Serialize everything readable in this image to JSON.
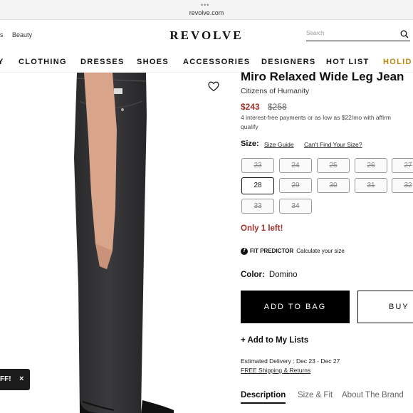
{
  "browser": {
    "url": "revolve.com",
    "dots": "•••"
  },
  "header": {
    "links": [
      "s",
      "Beauty"
    ],
    "logo": "REVOLVE",
    "search_placeholder": "Search"
  },
  "nav": {
    "items": [
      "Y",
      "CLOTHING",
      "DRESSES",
      "SHOES",
      "ACCESSORIES",
      "DESIGNERS",
      "HOT LIST",
      "HOLID"
    ]
  },
  "promo": {
    "text": "FF!",
    "close": "×"
  },
  "product": {
    "title": "Miro Relaxed Wide Leg Jean",
    "brand": "Citizens of Humanity",
    "price": "$243",
    "original_price": "$258",
    "affirm_text": "4 interest-free payments or as low as $22/mo with affirm",
    "affirm_qualify": "qualify",
    "size_label": "Size:",
    "size_guide": "Size Guide",
    "cant_find": "Can't Find Your Size?",
    "sizes": [
      {
        "label": "23",
        "available": false
      },
      {
        "label": "24",
        "available": false
      },
      {
        "label": "25",
        "available": false
      },
      {
        "label": "26",
        "available": false
      },
      {
        "label": "27",
        "available": false
      },
      {
        "label": "28",
        "available": true
      },
      {
        "label": "29",
        "available": false
      },
      {
        "label": "30",
        "available": false
      },
      {
        "label": "31",
        "available": false
      },
      {
        "label": "32",
        "available": false
      },
      {
        "label": "33",
        "available": false
      },
      {
        "label": "34",
        "available": false
      }
    ],
    "stock_note": "Only 1 left!",
    "fit_predictor": {
      "badge": "f",
      "name": "FIT PREDICTOR",
      "text": "Calculate your size"
    },
    "color_label": "Color:",
    "color_value": "Domino",
    "add_to_bag": "ADD TO BAG",
    "buy_now": "BUY N",
    "add_to_lists": "+ Add to My Lists",
    "delivery": "Estimated Delivery : Dec 23 - Dec 27",
    "shipping": "FREE Shipping & Returns",
    "tabs": [
      "Description",
      "Size & Fit",
      "About The Brand"
    ]
  },
  "colors": {
    "sale_red": "#a3312b",
    "holiday_gold": "#b8860b",
    "button_black": "#000000"
  }
}
